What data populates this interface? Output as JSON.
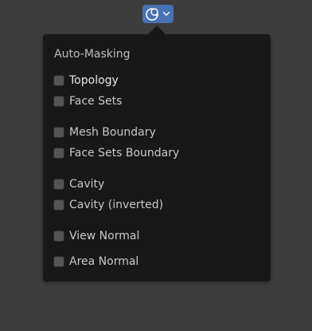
{
  "trigger": {
    "icon": "auto-masking-icon",
    "dropdown_icon": "chevron-down-icon",
    "color": "#4772b3"
  },
  "popover": {
    "title": "Auto-Masking",
    "options": [
      {
        "label": "Topology",
        "checked": false
      },
      {
        "label": "Face Sets",
        "checked": false
      },
      {
        "label": "Mesh Boundary",
        "checked": false
      },
      {
        "label": "Face Sets Boundary",
        "checked": false
      },
      {
        "label": "Cavity",
        "checked": false
      },
      {
        "label": "Cavity (inverted)",
        "checked": false
      },
      {
        "label": "View Normal",
        "checked": false
      },
      {
        "label": "Area Normal",
        "checked": false
      }
    ]
  }
}
